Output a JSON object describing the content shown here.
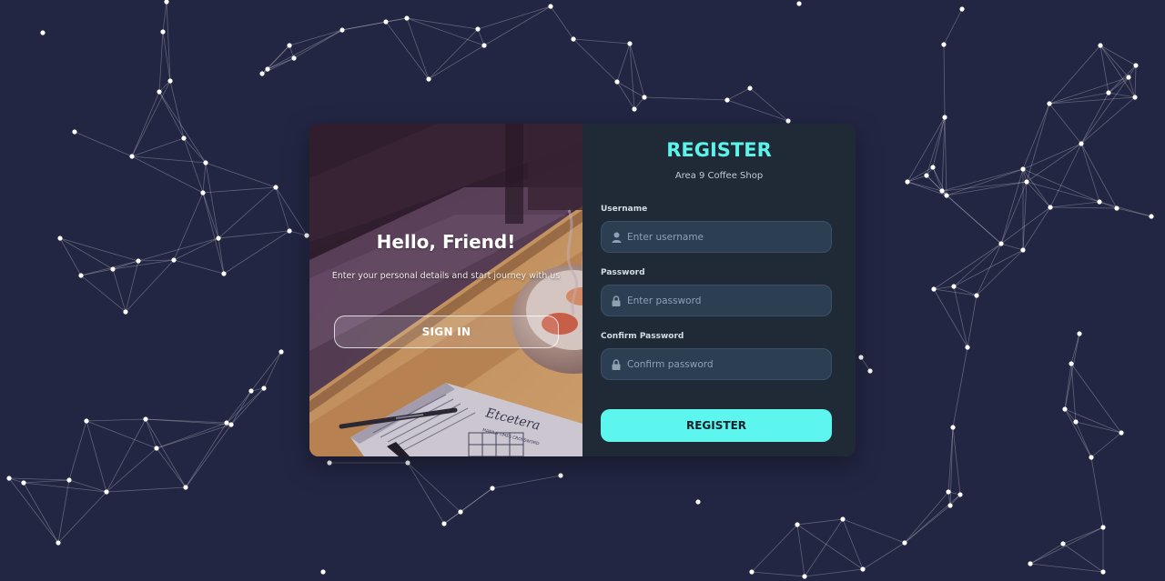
{
  "left_panel": {
    "title": "Hello, Friend!",
    "subtitle": "Enter your personal details and start journey with us",
    "signin_label": "SIGN IN",
    "illustration_text": "Etcetera",
    "illustration_small_text": "MANILA TIMES CROSSWORD"
  },
  "right_panel": {
    "title": "REGISTER",
    "subtitle": "Area 9 Coffee Shop",
    "fields": [
      {
        "label": "Username",
        "placeholder": "Enter username",
        "icon": "user-icon"
      },
      {
        "label": "Password",
        "placeholder": "Enter password",
        "icon": "lock-icon"
      },
      {
        "label": "Confirm Password",
        "placeholder": "Confirm password",
        "icon": "lock-icon"
      }
    ],
    "register_label": "REGISTER"
  },
  "colors": {
    "background": "#232643",
    "accent": "#5cf6ee",
    "form_panel": "#1f2a36",
    "input_bg": "#2c3e52"
  }
}
